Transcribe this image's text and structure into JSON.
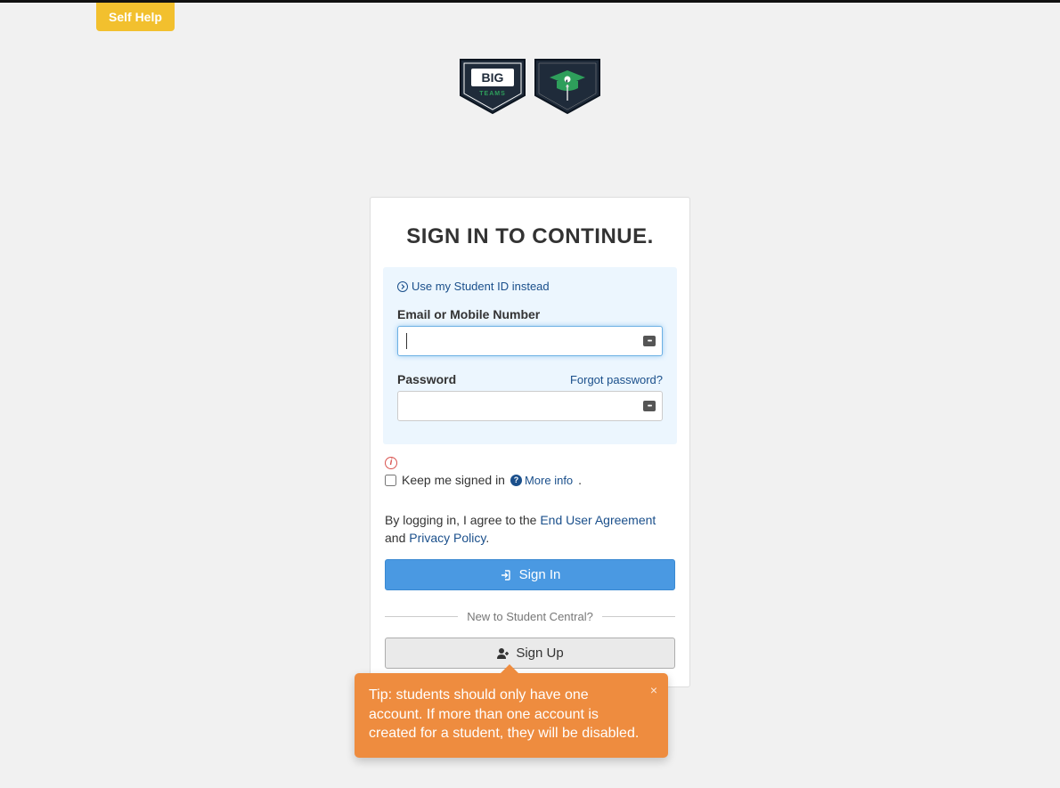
{
  "selfHelp": "Self Help",
  "title": "SIGN IN TO CONTINUE.",
  "studentIdLink": "Use my Student ID instead",
  "emailLabel": "Email or Mobile Number",
  "emailValue": "",
  "passwordLabel": "Password",
  "forgotPassword": "Forgot password?",
  "passwordValue": "",
  "keepSignedIn": "Keep me signed in",
  "moreInfo": "More info",
  "agreement": {
    "prefix": "By logging in, I agree to the ",
    "eula": "End User Agreement",
    "mid": " and ",
    "privacy": "Privacy Policy",
    "suffix": "."
  },
  "signInLabel": "Sign In",
  "dividerText": "New to Student Central?",
  "signUpLabel": "Sign Up",
  "tooltip": "Tip: students should only have one account. If more than one account is created for a student, they will be disabled.",
  "brand": {
    "big": "BIG",
    "teams": "TEAMS"
  }
}
